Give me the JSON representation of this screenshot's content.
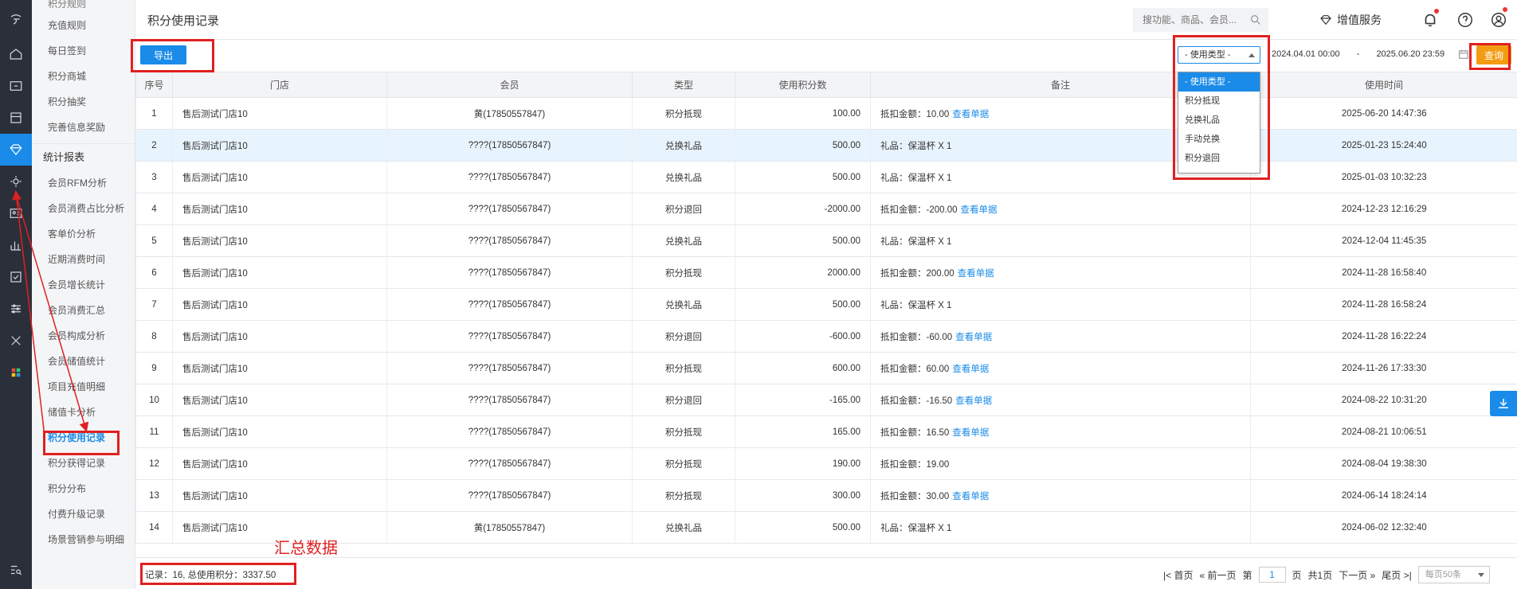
{
  "header": {
    "title": "积分使用记录",
    "search_placeholder": "搜功能、商品、会员...",
    "value_added_service": "增值服务"
  },
  "menu": {
    "top_cut": "积分规则",
    "items_top": [
      "充值规则",
      "每日签到",
      "积分商城",
      "积分抽奖",
      "完善信息奖励"
    ],
    "section": "统计报表",
    "items": [
      "会员RFM分析",
      "会员消费占比分析",
      "客单价分析",
      "近期消费时间",
      "会员增长统计",
      "会员消费汇总",
      "会员构成分析",
      "会员储值统计",
      "项目充值明细",
      "储值卡分析",
      "积分使用记录",
      "积分获得记录",
      "积分分布",
      "付费升级记录",
      "场景营销参与明细"
    ],
    "active": "积分使用记录"
  },
  "toolbar": {
    "export_label": "导出",
    "type_select": "- 使用类型 -",
    "date_start": "2024.04.01 00:00",
    "date_sep": "-",
    "date_end": "2025.06.20 23:59",
    "query_label": "查询"
  },
  "dropdown": {
    "options": [
      "- 使用类型 -",
      "积分抵现",
      "兑换礼品",
      "手动兑换",
      "积分退回"
    ],
    "selected": "- 使用类型 -"
  },
  "table": {
    "columns": [
      "序号",
      "门店",
      "会员",
      "类型",
      "使用积分数",
      "备注",
      "使用时间"
    ],
    "link_text": "查看单据",
    "rows": [
      {
        "no": "1",
        "store": "售后测试门店10",
        "member": "黄(17850557847)",
        "type": "积分抵现",
        "points": "100.00",
        "note": "抵扣金额：10.00",
        "link": true,
        "time": "2025-06-20 14:47:36"
      },
      {
        "no": "2",
        "store": "售后测试门店10",
        "member": "????(17850567847)",
        "type": "兑换礼品",
        "points": "500.00",
        "note": "礼品：保温杯 X 1",
        "link": false,
        "time": "2025-01-23 15:24:40"
      },
      {
        "no": "3",
        "store": "售后测试门店10",
        "member": "????(17850567847)",
        "type": "兑换礼品",
        "points": "500.00",
        "note": "礼品：保温杯 X 1",
        "link": false,
        "time": "2025-01-03 10:32:23"
      },
      {
        "no": "4",
        "store": "售后测试门店10",
        "member": "????(17850567847)",
        "type": "积分退回",
        "points": "-2000.00",
        "note": "抵扣金额：-200.00",
        "link": true,
        "time": "2024-12-23 12:16:29"
      },
      {
        "no": "5",
        "store": "售后测试门店10",
        "member": "????(17850567847)",
        "type": "兑换礼品",
        "points": "500.00",
        "note": "礼品：保温杯 X 1",
        "link": false,
        "time": "2024-12-04 11:45:35"
      },
      {
        "no": "6",
        "store": "售后测试门店10",
        "member": "????(17850567847)",
        "type": "积分抵现",
        "points": "2000.00",
        "note": "抵扣金额：200.00",
        "link": true,
        "time": "2024-11-28 16:58:40"
      },
      {
        "no": "7",
        "store": "售后测试门店10",
        "member": "????(17850567847)",
        "type": "兑换礼品",
        "points": "500.00",
        "note": "礼品：保温杯 X 1",
        "link": false,
        "time": "2024-11-28 16:58:24"
      },
      {
        "no": "8",
        "store": "售后测试门店10",
        "member": "????(17850567847)",
        "type": "积分退回",
        "points": "-600.00",
        "note": "抵扣金额：-60.00",
        "link": true,
        "time": "2024-11-28 16:22:24"
      },
      {
        "no": "9",
        "store": "售后测试门店10",
        "member": "????(17850567847)",
        "type": "积分抵现",
        "points": "600.00",
        "note": "抵扣金额：60.00",
        "link": true,
        "time": "2024-11-26 17:33:30"
      },
      {
        "no": "10",
        "store": "售后测试门店10",
        "member": "????(17850567847)",
        "type": "积分退回",
        "points": "-165.00",
        "note": "抵扣金额：-16.50",
        "link": true,
        "time": "2024-08-22 10:31:20"
      },
      {
        "no": "11",
        "store": "售后测试门店10",
        "member": "????(17850567847)",
        "type": "积分抵现",
        "points": "165.00",
        "note": "抵扣金额：16.50",
        "link": true,
        "time": "2024-08-21 10:06:51"
      },
      {
        "no": "12",
        "store": "售后测试门店10",
        "member": "????(17850567847)",
        "type": "积分抵现",
        "points": "190.00",
        "note": "抵扣金额：19.00",
        "link": false,
        "time": "2024-08-04 19:38:30"
      },
      {
        "no": "13",
        "store": "售后测试门店10",
        "member": "????(17850567847)",
        "type": "积分抵现",
        "points": "300.00",
        "note": "抵扣金额：30.00",
        "link": true,
        "time": "2024-06-14 18:24:14"
      },
      {
        "no": "14",
        "store": "售后测试门店10",
        "member": "黄(17850557847)",
        "type": "兑换礼品",
        "points": "500.00",
        "note": "礼品：保温杯 X 1",
        "link": false,
        "time": "2024-06-02 12:32:40"
      }
    ]
  },
  "footer": {
    "summary": "记录：16, 总使用积分：3337.50",
    "first": "首页",
    "prev": "前一页",
    "page_prefix": "第",
    "page_value": "1",
    "page_suffix": "页",
    "total_pages": "共1页",
    "next": "下一页",
    "last": "尾页",
    "page_size": "每页50条"
  },
  "annotation": {
    "label": "汇总数据",
    "color": "#e02020"
  },
  "colors": {
    "accent": "#1a8be8",
    "query_button": "#f39c12",
    "rail_bg": "#2b2f3a"
  }
}
